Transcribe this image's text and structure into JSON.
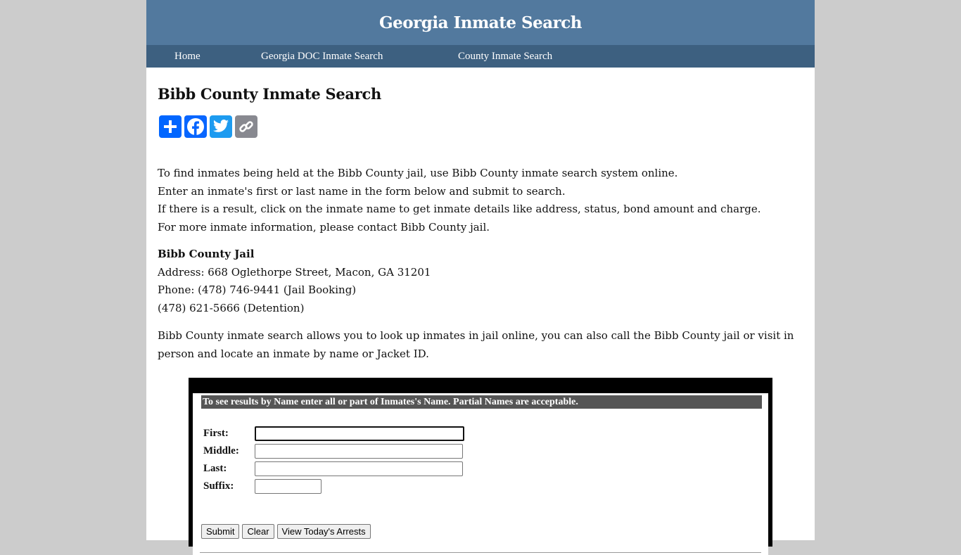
{
  "header": {
    "site_title": "Georgia Inmate Search"
  },
  "nav": {
    "items": [
      {
        "label": "Home"
      },
      {
        "label": "Georgia DOC Inmate Search"
      },
      {
        "label": "County Inmate Search"
      }
    ]
  },
  "page": {
    "title": "Bibb County Inmate Search"
  },
  "share": {
    "icons": [
      "share-plus-icon",
      "facebook-icon",
      "twitter-icon",
      "copy-link-icon"
    ],
    "colors": {
      "share": "#0166ff",
      "facebook": "#0866ff",
      "twitter": "#1d9bf0",
      "copy": "#888990"
    }
  },
  "intro": {
    "lines": [
      "To find inmates being held at the Bibb County jail, use Bibb County inmate search system online.",
      "Enter an inmate's first or last name in the form below and submit to search.",
      "If there is a result, click on the inmate name to get inmate details like address, status, bond amount and charge.",
      "For more inmate information, please contact Bibb County jail."
    ]
  },
  "jail": {
    "name": "Bibb County Jail",
    "address": "Address: 668 Oglethorpe Street, Macon, GA 31201",
    "phone": "Phone: (478) 746-9441 (Jail Booking)",
    "phone2": "(478) 621-5666 (Detention)"
  },
  "description": "Bibb County inmate search allows you to look up inmates in jail online, you can also call the Bibb County jail or visit in person and locate an inmate by name or Jacket ID.",
  "form": {
    "instructions": "To see results by Name enter all or part of Inmates's Name. Partial Names are acceptable.",
    "fields": {
      "first": {
        "label": "First:",
        "value": ""
      },
      "middle": {
        "label": "Middle:",
        "value": ""
      },
      "last": {
        "label": "Last:",
        "value": ""
      },
      "suffix": {
        "label": "Suffix:",
        "value": ""
      }
    },
    "buttons": {
      "submit": "Submit",
      "clear": "Clear",
      "today": "View Today's Arrests"
    }
  }
}
